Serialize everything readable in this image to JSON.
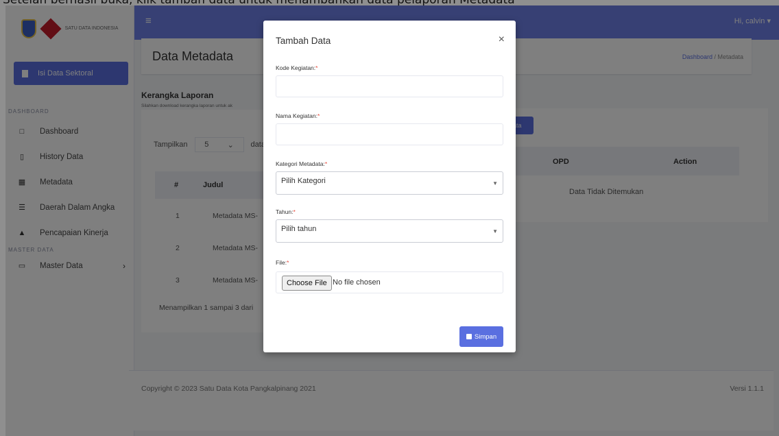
{
  "caption": "Setelah berhasil buka, klik tambah data untuk menambahkan data pelaporan Metadata",
  "sidebar": {
    "logo_text": "SATU DATA INDONESIA",
    "isi_button": "Isi Data Sektoral",
    "section_dashboard": "DASHBOARD",
    "items": [
      {
        "icon": "□",
        "label": "Dashboard"
      },
      {
        "icon": "▯",
        "label": "History Data"
      },
      {
        "icon": "▦",
        "label": "Metadata"
      },
      {
        "icon": "☰",
        "label": "Daerah Dalam Angka"
      },
      {
        "icon": "▲",
        "label": "Pencapaian Kinerja"
      }
    ],
    "section_master": "MASTER DATA",
    "master_item": {
      "icon": "▭",
      "label": "Master Data",
      "chevron": "›"
    }
  },
  "topbar": {
    "menu_icon": "≡",
    "user": "Hi, calvin ▾"
  },
  "header": {
    "title": "Data Metadata",
    "crumb_home": "Dashboard",
    "crumb_sep": " / ",
    "crumb_current": "Metadata"
  },
  "kerangka": {
    "title": "Kerangka Laporan",
    "subtitle": "Silahkan download kerangka laporan untuk ak"
  },
  "table": {
    "show_label": "Tampilkan",
    "show_value": "5",
    "show_suffix": "data",
    "col_num": "#",
    "col_judul": "Judul",
    "rows": [
      {
        "n": "1",
        "judul": "Metadata MS-"
      },
      {
        "n": "2",
        "judul": "Metadata MS-"
      },
      {
        "n": "3",
        "judul": "Metadata MS-"
      }
    ],
    "showing": "Menampilkan 1 sampai 3 dari"
  },
  "right": {
    "add_button": "ata",
    "col_opd": "OPD",
    "col_action": "Action",
    "empty": "Data Tidak Ditemukan"
  },
  "footer": {
    "copyright": "Copyright © 2023 Satu Data Kota Pangkalpinang 2021",
    "version": "Versi 1.1.1"
  },
  "modal": {
    "title": "Tambah Data",
    "close": "×",
    "kode_label": "Kode Kegiatan:",
    "nama_label": "Nama Kegiatan:",
    "kategori_label": "Kategori Metadata:",
    "kategori_value": "Pilih Kategori",
    "tahun_label": "Tahun:",
    "tahun_value": "Pilih tahun",
    "file_label": "File:",
    "choose_file": "Choose File",
    "no_file": "No file chosen",
    "required_mark": "*",
    "save": "Simpan"
  }
}
